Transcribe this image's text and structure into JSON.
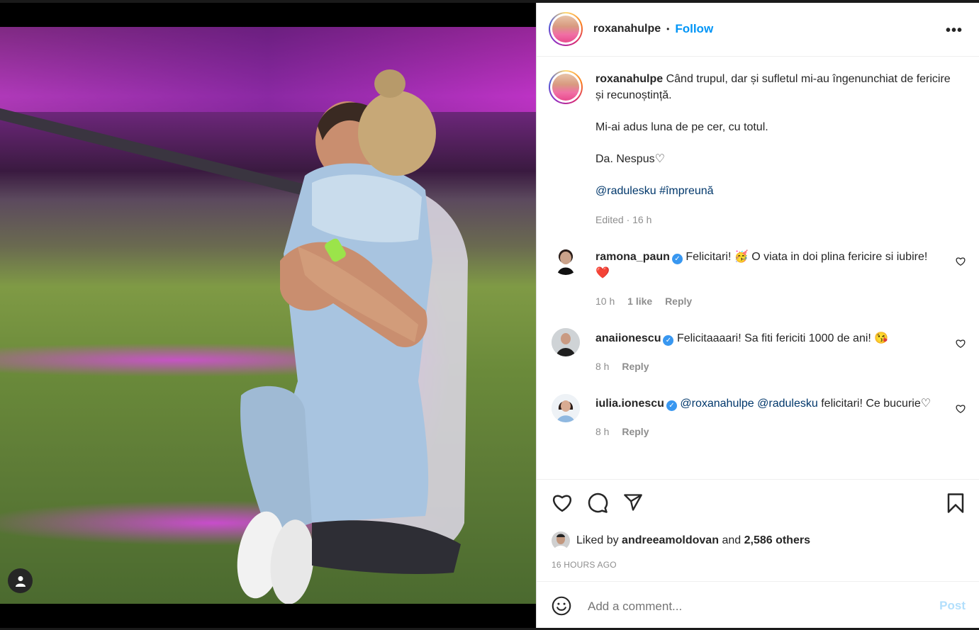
{
  "post_header": {
    "username": "roxanahulpe",
    "separator": "•",
    "follow_label": "Follow",
    "more_label": "•••"
  },
  "caption": {
    "username": "roxanahulpe",
    "line1": "Când trupul, dar și sufletul mi-au îngenunchiat de fericire și recunoștință.",
    "line2": "Mi-ai adus luna de pe cer, cu totul.",
    "line3": "Da. Nespus♡",
    "mention": "@radulesku",
    "hashtag": "#împreună",
    "meta": "Edited · 16 h"
  },
  "comments": [
    {
      "username": "ramona_paun",
      "text": "Felicitari! 🥳 O viata in doi plina fericire si iubire! ❤️",
      "time": "10 h",
      "likes": "1 like",
      "reply": "Reply"
    },
    {
      "username": "anaiionescu",
      "text": "Felicitaaaari! Sa fiti fericiti 1000 de ani! 😘",
      "time": "8 h",
      "reply": "Reply"
    },
    {
      "username": "iulia.ionescu",
      "mention1": "@roxanahulpe",
      "mention2": "@radulesku",
      "text": "felicitari! Ce bucurie♡",
      "time": "8 h",
      "reply": "Reply"
    }
  ],
  "likes": {
    "prefix": "Liked by",
    "user": "andreeamoldovan",
    "and": "and",
    "others": "2,586 others"
  },
  "timestamp": "16 HOURS AGO",
  "add_comment": {
    "placeholder": "Add a comment...",
    "post_label": "Post"
  },
  "colors": {
    "accent": "#0095f6",
    "link": "#00376b",
    "muted": "#8e8e8e",
    "post_disabled": "#b2dffc",
    "heart_red": "#ed4956"
  },
  "icons": [
    "heart-icon",
    "comment-icon",
    "share-icon",
    "bookmark-icon",
    "emoji-icon",
    "more-icon",
    "verified-icon",
    "user-tag-icon"
  ]
}
